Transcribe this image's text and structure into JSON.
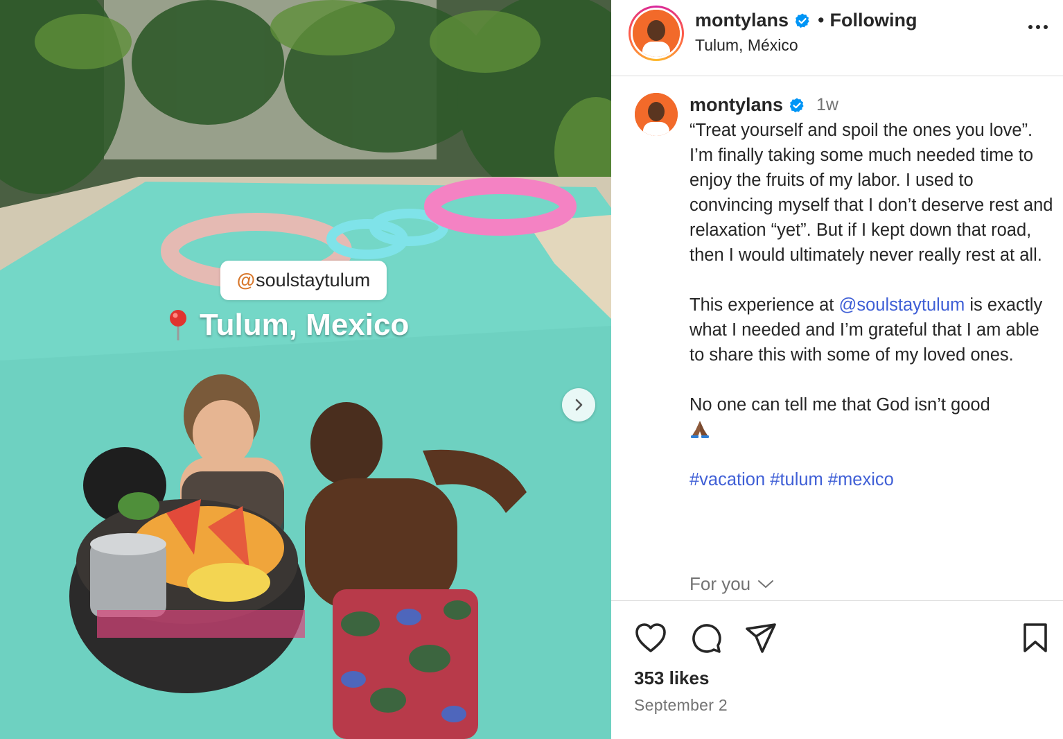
{
  "post": {
    "username": "montylans",
    "follow_status": "Following",
    "location": "Tulum, México",
    "time_ago": "1w",
    "likes": "353 likes",
    "date": "September 2"
  },
  "media": {
    "tag_handle": "soulstaytulum",
    "tag_at": "@",
    "location_sticker": "Tulum, Mexico"
  },
  "caption": {
    "para1": "“Treat yourself and spoil the ones you love”. I’m finally taking some much needed time to enjoy the fruits of my labor. I used to convincing myself that I don’t deserve rest and relaxation “yet”. But if I kept down that road, then I would ultimately never really rest at all.",
    "para2_before": "This experience at ",
    "para2_link": "@soulstaytulum",
    "para2_after": " is exactly what I needed and I’m grateful that I am able to share this with some of my loved ones.",
    "para3": "No one can tell me that God isn’t good",
    "hashtags": "#vacation #tulum #mexico",
    "for_you": "For you"
  },
  "icons": [
    "verified-badge-icon",
    "more-options-icon",
    "heart-icon",
    "comment-icon",
    "share-icon",
    "bookmark-icon",
    "chevron-right-icon",
    "chevron-down-icon",
    "map-pin-icon",
    "praying-hands-emoji"
  ],
  "colors": {
    "verified": "#0095f6",
    "link": "#3f5fd6",
    "muted": "#737373",
    "text": "#262626"
  }
}
